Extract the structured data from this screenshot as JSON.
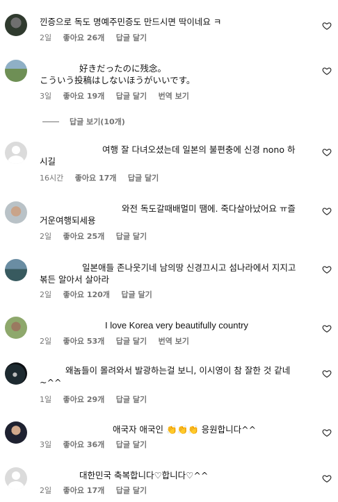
{
  "comments": [
    {
      "text": "낀증으로 독도 명예주민증도 만드시면 딱이네요 ㅋ",
      "time": "2일",
      "likes": "좋아요 26개",
      "reply": "답글 달기"
    },
    {
      "text1": "好きだったのに残念。",
      "text2": "こういう投稿はしないほうがいいです。",
      "time": "3일",
      "likes": "좋아요 19개",
      "reply": "답글 달기",
      "translate": "번역 보기"
    },
    {
      "text": "여행 잘 다녀오셨는데 일본의 불편충에 신경 nono 하시길",
      "time": "16시간",
      "likes": "좋아요 17개",
      "reply": "답글 달기"
    },
    {
      "text": "와전 독도갈때배멀미 땜에. 죽다살아났어요 ㅠ즐거운여행되세용",
      "time": "2일",
      "likes": "좋아요 25개",
      "reply": "답글 달기"
    },
    {
      "text": "일본애들 존나웃기네 남의땅 신경끄시고 섬나라에서 지지고볶든 알아서 살아라",
      "time": "2일",
      "likes": "좋아요 120개",
      "reply": "답글 달기"
    },
    {
      "text": "I love Korea very beautifully country",
      "time": "2일",
      "likes": "좋아요 53개",
      "reply": "답글 달기",
      "translate": "번역 보기"
    },
    {
      "text": "왜놈들이 몰려와서 발광하는걸 보니, 이시영이 참 잘한 것 같네~^^",
      "time": "1일",
      "likes": "좋아요 29개",
      "reply": "답글 달기"
    },
    {
      "text_a": "애국자 애국인 ",
      "emoji": "👏👏👏",
      "text_b": " 응원합니다^^",
      "time": "3일",
      "likes": "좋아요 36개",
      "reply": "답글 달기"
    },
    {
      "text": "대한민국 축복합니다♡합니다♡^^",
      "time": "2일",
      "likes": "좋아요 17개",
      "reply": "답글 달기"
    }
  ],
  "replies_toggle": "답글 보기(10개)",
  "icons": {
    "like": "heart-outline-icon"
  }
}
